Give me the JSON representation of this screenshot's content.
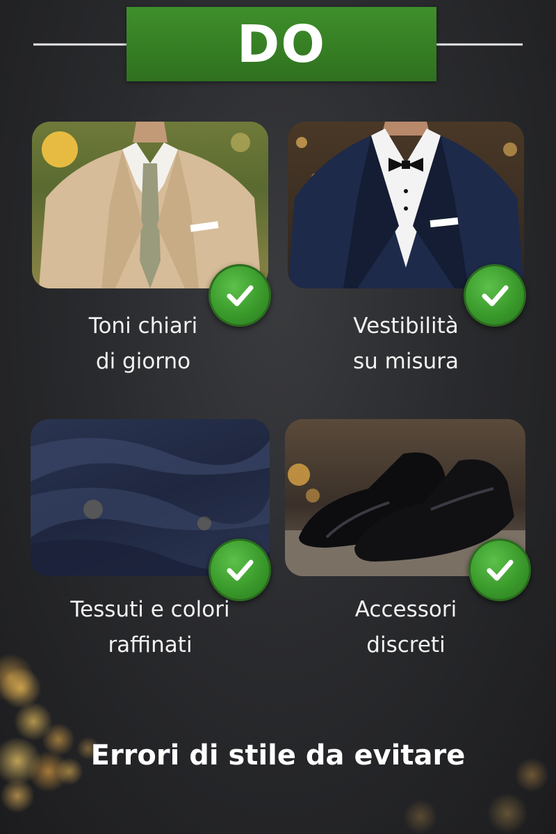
{
  "banner": {
    "label": "DO",
    "color": "#3a8a28"
  },
  "items": [
    {
      "caption_line1": "Toni chiari",
      "caption_line2": "di giorno",
      "image": "beige-suit-daytime",
      "status_icon": "check-icon"
    },
    {
      "caption_line1": "Vestibilità",
      "caption_line2": "su misura",
      "image": "navy-tuxedo-bowtie",
      "status_icon": "check-icon"
    },
    {
      "caption_line1": "Tessuti e colori",
      "caption_line2": "raffinati",
      "image": "navy-fabric-texture",
      "status_icon": "check-icon"
    },
    {
      "caption_line1": "Accessori",
      "caption_line2": "discreti",
      "image": "patent-leather-shoes",
      "status_icon": "check-icon"
    }
  ],
  "footer": {
    "title": "Errori di stile da evitare"
  },
  "colors": {
    "background": "#2a2b2e",
    "check": "#3a9a2b",
    "text": "#f2f2f2"
  }
}
